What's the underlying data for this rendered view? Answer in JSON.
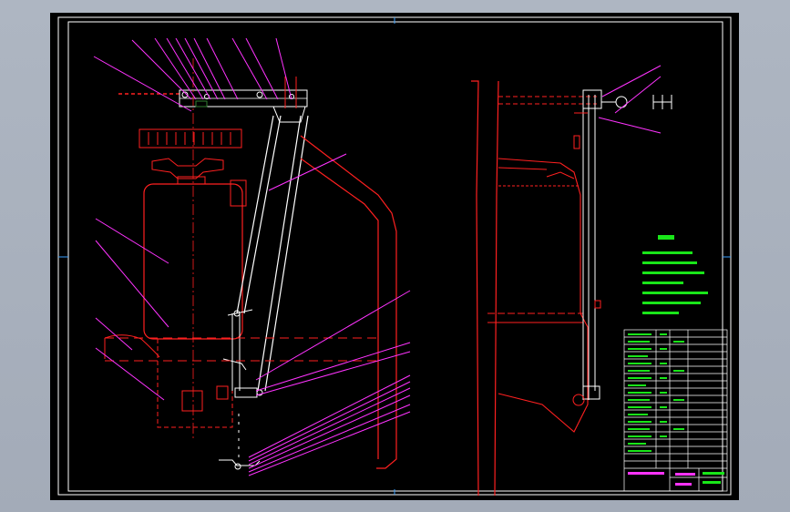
{
  "colors": {
    "background": "#000000",
    "viewport": "#a9b1bd",
    "frame": "#ffffff",
    "outline_red": "#ff2020",
    "leader_magenta": "#ff33ff",
    "notes_green": "#19e619",
    "structure_white": "#ffffff",
    "cyan_marks": "#00ffff"
  },
  "drawing": {
    "left_view": "assembly-front-view",
    "right_view": "assembly-side-view",
    "notes_title": "技术要求"
  }
}
